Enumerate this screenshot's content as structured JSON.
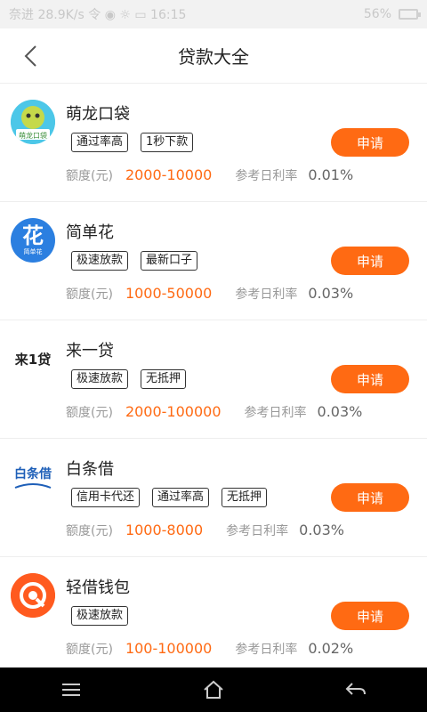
{
  "status_bar": {
    "left_text": "奈进 28.9K/s 令 ◉ ☼ ▭   16:15",
    "battery": "56%"
  },
  "header": {
    "title": "贷款大全"
  },
  "labels": {
    "amount_label": "额度(元)",
    "rate_label": "参考日利率",
    "apply": "申请"
  },
  "loans": [
    {
      "name": "萌龙口袋",
      "logo_text": "萌龙口袋",
      "tags": [
        "通过率高",
        "1秒下款"
      ],
      "amount": "2000-10000",
      "rate": "0.01%"
    },
    {
      "name": "简单花",
      "logo_text": "花",
      "logo_sub": "简单花",
      "tags": [
        "极速放款",
        "最新口子"
      ],
      "amount": "1000-50000",
      "rate": "0.03%"
    },
    {
      "name": "来一贷",
      "logo_text": "来1贷",
      "tags": [
        "极速放款",
        "无抵押"
      ],
      "amount": "2000-100000",
      "rate": "0.03%"
    },
    {
      "name": "白条借",
      "logo_text": "白条借",
      "tags": [
        "信用卡代还",
        "通过率高",
        "无抵押"
      ],
      "amount": "1000-8000",
      "rate": "0.03%"
    },
    {
      "name": "轻借钱包",
      "logo_text": "Q",
      "tags": [
        "极速放款"
      ],
      "amount": "100-100000",
      "rate": "0.02%"
    }
  ],
  "colors": {
    "accent": "#ff6a13",
    "navbar": "#000000"
  },
  "nav": {
    "icons": [
      "menu-icon",
      "home-icon",
      "back-arrow-icon"
    ]
  }
}
